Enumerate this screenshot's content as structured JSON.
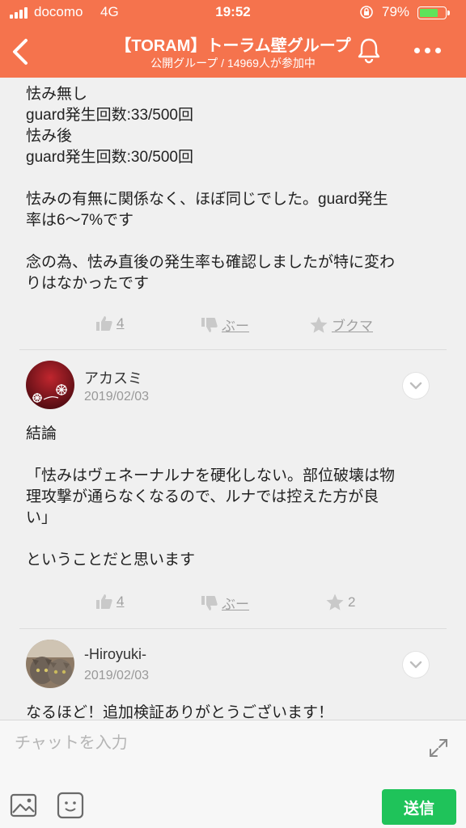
{
  "status_bar": {
    "carrier": "docomo",
    "network": "4G",
    "time": "19:52",
    "battery_percent": "79%",
    "battery_level": 0.79,
    "battery_color": "#5fe35a"
  },
  "header": {
    "title": "【TORAM】トーラム壁グループ",
    "subtitle": "公開グループ / 14969人が参加中",
    "background": "#f5734d",
    "icons": [
      "back-arrow-icon",
      "bell-icon",
      "more-dots-icon"
    ]
  },
  "posts": [
    {
      "lines": [
        "怯み無し",
        "guard発生回数:33/500回",
        "怯み後",
        "guard発生回数:30/500回",
        "",
        "怯みの有無に関係なく、ほぼ同じでした。guard発生",
        "率は6〜7%です",
        "",
        "念の為、怯み直後の発生率も確認しましたが特に変わ",
        "りはなかったです"
      ],
      "reactions": {
        "like": "4",
        "boo": "ぶー",
        "bookmark": "ブクマ"
      }
    },
    {
      "author": "アカスミ",
      "date": "2019/02/03",
      "lines": [
        "結論",
        "",
        "「怯みはヴェネーナルナを硬化しない。部位破壊は物",
        "理攻撃が通らなくなるので、ルナでは控えた方が良",
        "い」",
        "",
        "ということだと思います"
      ],
      "reactions": {
        "like": "4",
        "boo": "ぶー",
        "bookmark": "2"
      }
    },
    {
      "author": "-Hiroyuki-",
      "date": "2019/02/03",
      "lines": [
        "なるほど！追加検証ありがとうございます！"
      ]
    }
  ],
  "composer": {
    "placeholder": "チャットを入力",
    "value": "",
    "send_label": "送信",
    "send_color": "#1fc35a"
  }
}
